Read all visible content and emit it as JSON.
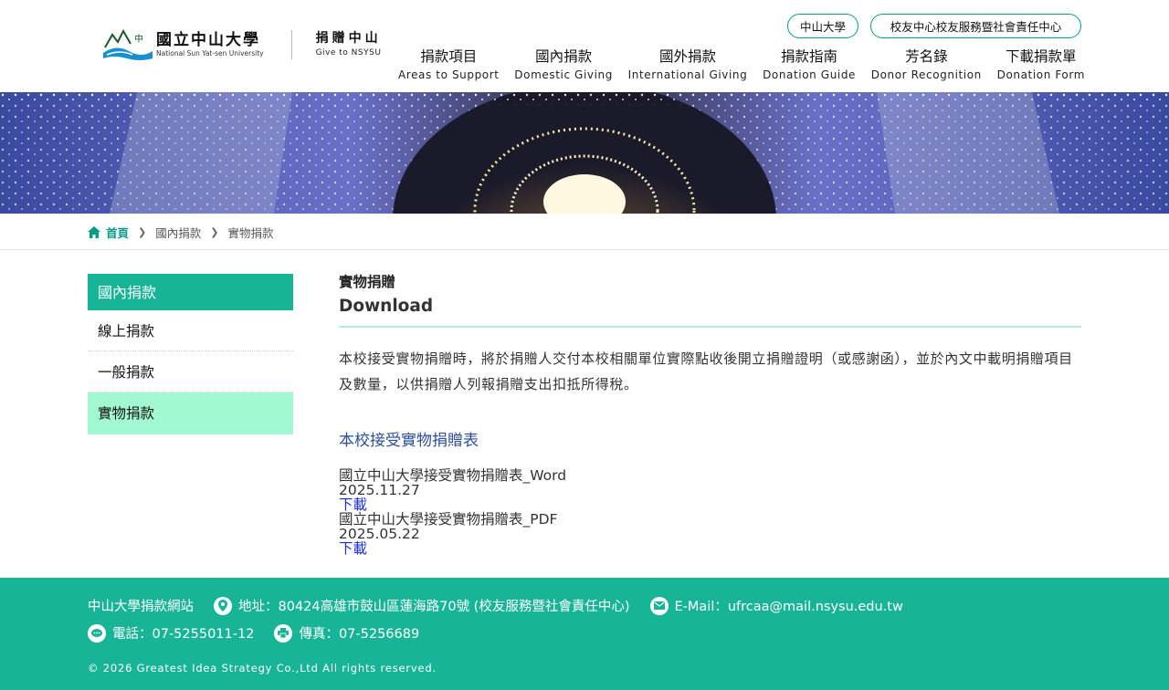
{
  "header": {
    "logo_cn": "國立中山大學",
    "logo_en": "National Sun Yat-sen University",
    "give_cn": "捐贈中山",
    "give_en": "Give to NSYSU",
    "top_links": [
      "中山大學",
      "校友中心校友服務暨社會責任中心"
    ],
    "nav": [
      {
        "cn": "捐款項目",
        "en": "Areas to Support"
      },
      {
        "cn": "國內捐款",
        "en": "Domestic Giving"
      },
      {
        "cn": "國外捐款",
        "en": "International Giving"
      },
      {
        "cn": "捐款指南",
        "en": "Donation Guide"
      },
      {
        "cn": "芳名錄",
        "en": "Donor Recognition"
      },
      {
        "cn": "下載捐款單",
        "en": "Donation Form"
      }
    ]
  },
  "breadcrumb": [
    "首頁",
    "國內捐款",
    "實物捐款"
  ],
  "sidebar": {
    "heading": "國內捐款",
    "items": [
      "線上捐款",
      "一般捐款",
      "實物捐款"
    ]
  },
  "main": {
    "title_cn": "實物捐贈",
    "title_en": "Download",
    "intro": "本校接受實物捐贈時，將於捐贈人交付本校相關單位實際點收後開立捐贈證明（或感謝函），並於內文中載明捐贈項目及數量，以供捐贈人列報捐贈支出扣抵所得稅。",
    "download_heading": "本校接受實物捐贈表",
    "files": [
      {
        "name": "國立中山大學接受實物捐贈表_Word",
        "date": "2025.11.27",
        "link": "下載"
      },
      {
        "name": "國立中山大學接受實物捐贈表_PDF",
        "date": "2025.05.22",
        "link": "下載"
      }
    ]
  },
  "footer": {
    "site": "中山大學捐款網站",
    "address": "地址：80424高雄市鼓山區蓮海路70號 (校友服務暨社會責任中心)",
    "email": "E-Mail：ufrcaa@mail.nsysu.edu.tw",
    "phone": "電話：07-5255011-12",
    "fax": "傳真：07-5256689",
    "copyright": "© 2026 Greatest Idea Strategy Co.,Ltd All rights reserved."
  },
  "colors": {
    "accent": "#18b497",
    "sidebar_active": "#a2f9d1",
    "link": "#1a2fd0",
    "heading_blue": "#2a4e9a"
  },
  "icons": [
    "nsysu-logo-icon",
    "home-icon",
    "chevron-right-icon",
    "location-icon",
    "mail-icon",
    "chat-icon",
    "fax-icon"
  ]
}
